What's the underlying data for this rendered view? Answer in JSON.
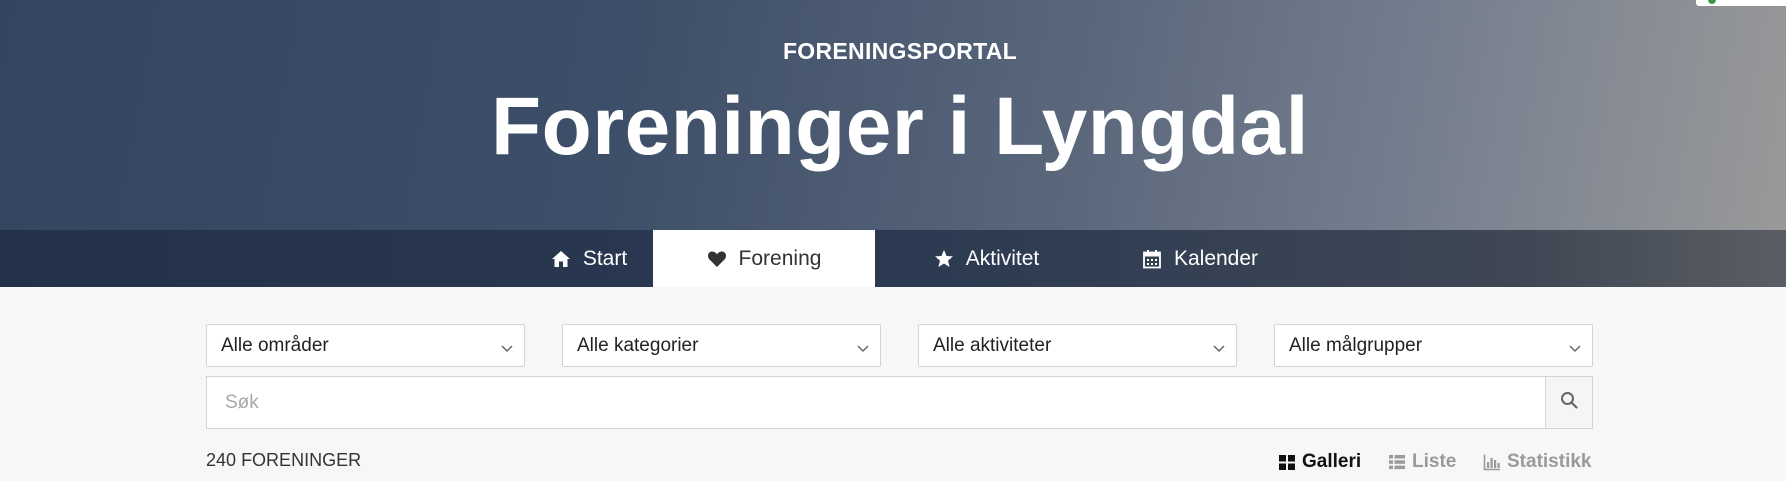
{
  "header": {
    "kicker": "FORENINGSPORTAL",
    "title": "Foreninger i Lyngdal"
  },
  "nav": {
    "items": [
      {
        "label": "Start",
        "icon": "home-icon",
        "active": false
      },
      {
        "label": "Forening",
        "icon": "heart-icon",
        "active": true
      },
      {
        "label": "Aktivitet",
        "icon": "star-icon",
        "active": false
      },
      {
        "label": "Kalender",
        "icon": "calendar-icon",
        "active": false
      }
    ]
  },
  "filters": {
    "area": "Alle områder",
    "category": "Alle kategorier",
    "activity": "Alle aktiviteter",
    "audience": "Alle målgrupper"
  },
  "search": {
    "placeholder": "Søk"
  },
  "results": {
    "count": "240",
    "label": "FORENINGER"
  },
  "views": {
    "galleri": "Galleri",
    "liste": "Liste",
    "statistikk": "Statistikk"
  },
  "colors": {
    "hero_start": "#34455f",
    "navbar": "#233149",
    "active_tab_bg": "#ffffff",
    "inactive_view": "#9a9a9a"
  }
}
